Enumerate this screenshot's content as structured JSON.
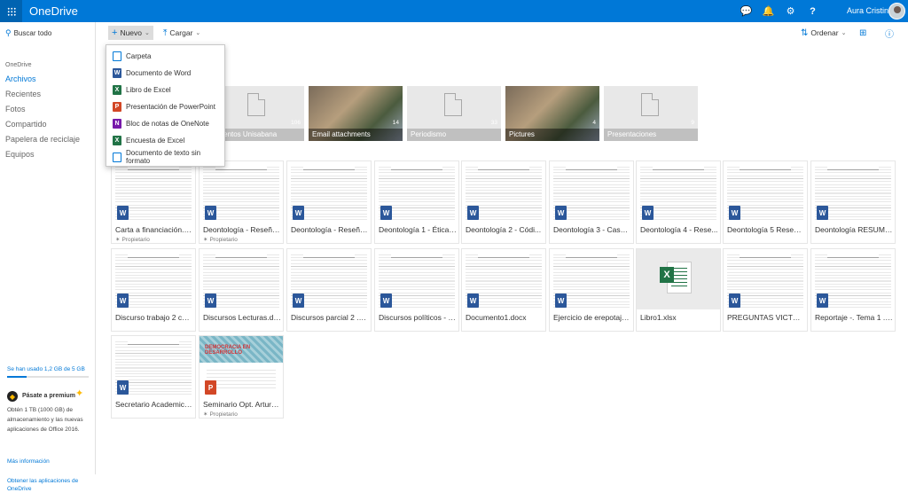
{
  "topbar": {
    "app_title": "OneDrive",
    "user_name": "Aura Cristina",
    "icons": [
      "chat-icon",
      "bell-icon",
      "gear-icon",
      "help-icon"
    ]
  },
  "sidebar": {
    "search_label": "Buscar todo",
    "section": "OneDrive",
    "items": [
      {
        "label": "Archivos",
        "active": true
      },
      {
        "label": "Recientes",
        "active": false
      },
      {
        "label": "Fotos",
        "active": false
      },
      {
        "label": "Compartido",
        "active": false
      },
      {
        "label": "Papelera de reciclaje",
        "active": false
      },
      {
        "label": "Equipos",
        "active": false
      }
    ],
    "quota_text": "Se han usado 1,2 GB de 5 GB",
    "quota_fraction": 0.24,
    "premium_title": "Pásate a premium",
    "premium_text": "Obtén 1 TB (1000 GB) de almacenamiento y las nuevas aplicaciones de Office 2016.",
    "premium_more": "Más información",
    "get_apps": "Obtener las aplicaciones de OneDrive"
  },
  "commands": {
    "new_label": "Nuevo",
    "upload_label": "Cargar",
    "sort_label": "Ordenar"
  },
  "new_menu": [
    {
      "label": "Carpeta",
      "icon": "folder-outline-icon"
    },
    {
      "label": "Documento de Word",
      "icon": "word-icon"
    },
    {
      "label": "Libro de Excel",
      "icon": "excel-icon"
    },
    {
      "label": "Presentación de PowerPoint",
      "icon": "powerpoint-icon"
    },
    {
      "label": "Bloc de notas de OneNote",
      "icon": "onenote-icon"
    },
    {
      "label": "Encuesta de Excel",
      "icon": "excel-survey-icon"
    },
    {
      "label": "Documento de texto sin formato",
      "icon": "text-file-icon"
    }
  ],
  "folders": [
    {
      "name": "umentos Unisabana",
      "count": "106",
      "photo": false
    },
    {
      "name": "Email attachments",
      "count": "14",
      "photo": true
    },
    {
      "name": "Periodismo",
      "count": "33",
      "photo": false
    },
    {
      "name": "Pictures",
      "count": "4",
      "photo": true
    },
    {
      "name": "Presentaciones",
      "count": "9",
      "photo": false
    }
  ],
  "files": [
    {
      "name": "Carta a financiación.d...",
      "type": "w",
      "owner": "Propietario"
    },
    {
      "name": "Deontología - Reseña...",
      "type": "w",
      "owner": "Propietario"
    },
    {
      "name": "Deontología - Reseña...",
      "type": "w",
      "owner": ""
    },
    {
      "name": "Deontología 1 - Ética ...",
      "type": "w",
      "owner": ""
    },
    {
      "name": "Deontología 2 - Códi...",
      "type": "w",
      "owner": ""
    },
    {
      "name": "Deontología 3 - Caso ...",
      "type": "w",
      "owner": ""
    },
    {
      "name": "Deontología 4 - Rese...",
      "type": "w",
      "owner": ""
    },
    {
      "name": "Deontología 5 Reseña...",
      "type": "w",
      "owner": ""
    },
    {
      "name": "Deontología RESUME...",
      "type": "w",
      "owner": ""
    },
    {
      "name": "Discurso trabajo 2 cor...",
      "type": "w",
      "owner": ""
    },
    {
      "name": "Discursos Lecturas.docx",
      "type": "w",
      "owner": ""
    },
    {
      "name": "Discursos parcial 2 .d...",
      "type": "w",
      "owner": ""
    },
    {
      "name": "Discursos políticos - P...",
      "type": "w",
      "owner": ""
    },
    {
      "name": "Documento1.docx",
      "type": "w",
      "owner": ""
    },
    {
      "name": "Ejercicio de erepotaje...",
      "type": "w",
      "owner": ""
    },
    {
      "name": "Libro1.xlsx",
      "type": "x",
      "owner": ""
    },
    {
      "name": "PREGUNTAS VICTORI...",
      "type": "w",
      "owner": ""
    },
    {
      "name": "Reportaje -. Tema 1 .d...",
      "type": "w",
      "owner": ""
    },
    {
      "name": "Secretario Academico ...",
      "type": "w",
      "owner": ""
    },
    {
      "name": "Seminario Opt. Arturo...",
      "type": "p",
      "owner": "Propietario",
      "thumb_title": "DEMOCRACIA EN DESARROLLO"
    }
  ]
}
